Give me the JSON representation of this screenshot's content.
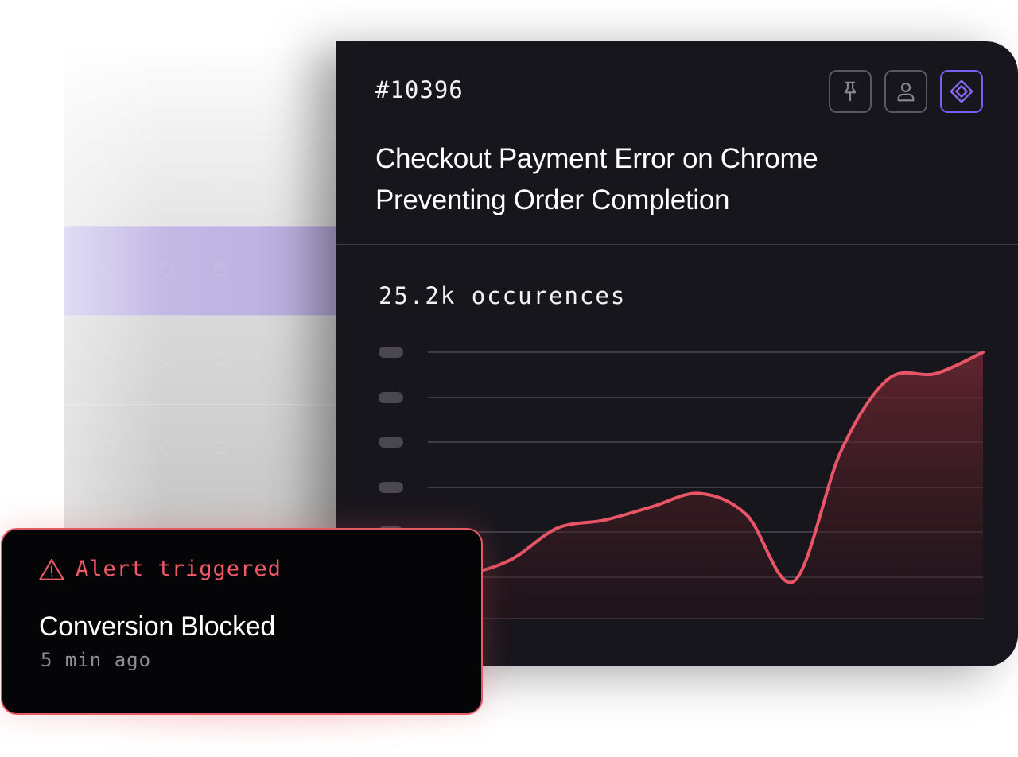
{
  "issue": {
    "id": "#10396",
    "title_line1": "Checkout Payment Error on Chrome",
    "title_line2": "Preventing Order Completion",
    "occurrences_label": "25.2k occurences"
  },
  "actions": [
    {
      "name": "pin",
      "icon": "pin-icon",
      "active": false
    },
    {
      "name": "assign",
      "icon": "user-icon",
      "active": false
    },
    {
      "name": "integration",
      "icon": "diamond-icon",
      "active": true
    }
  ],
  "colors": {
    "card_bg": "#18161d",
    "line": "#e85566",
    "active_accent": "#7c5cf2",
    "selected_row": "#bdb4e2",
    "alert_border": "#e75a67"
  },
  "alert": {
    "label": "Alert triggered",
    "title": "Conversion Blocked",
    "time": "5 min ago",
    "icon": "warning-triangle-icon"
  },
  "chart_data": {
    "type": "area",
    "title": "25.2k occurences",
    "ylabel": "",
    "y_tick_labels_redacted": true,
    "grid": true,
    "x": [
      0,
      1,
      2,
      3,
      4,
      5,
      6,
      7,
      8,
      9,
      10,
      11,
      12,
      13
    ],
    "series": [
      {
        "values": [
          2.9,
          2.0,
          1.7,
          2.2,
          3.4,
          3.7,
          4.2,
          4.7,
          3.9,
          1.4,
          6.3,
          9.0,
          9.2,
          10.0
        ]
      }
    ],
    "ylim": [
      0,
      10
    ]
  }
}
